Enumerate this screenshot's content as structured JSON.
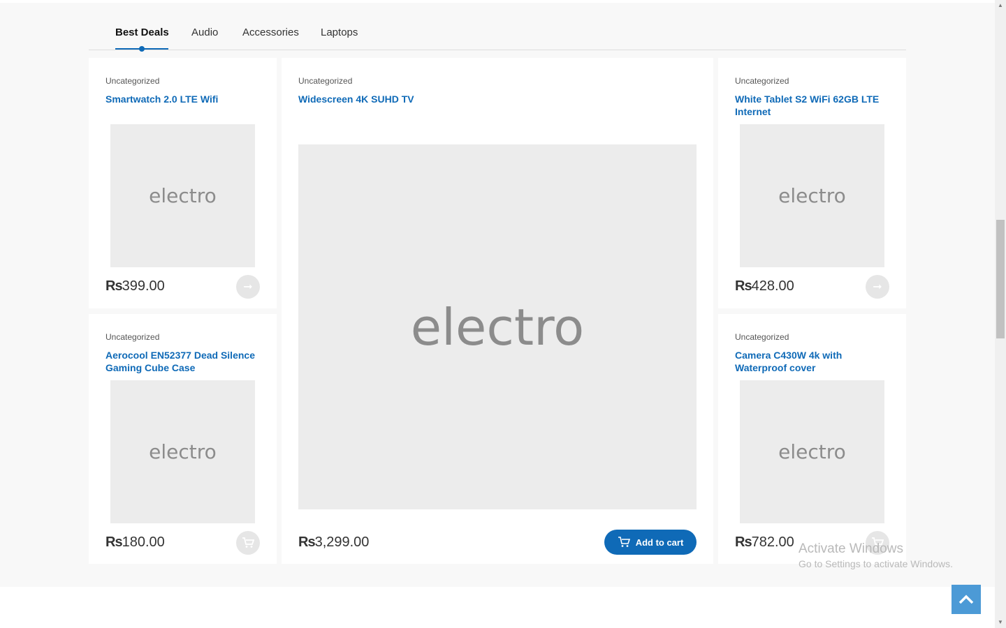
{
  "tabs": [
    {
      "label": "Best Deals",
      "active": true
    },
    {
      "label": "Audio"
    },
    {
      "label": "Accessories"
    },
    {
      "label": "Laptops"
    }
  ],
  "products": [
    {
      "category": "Uncategorized",
      "name": "Smartwatch 2.0 LTE Wifi",
      "image_text": "electro",
      "currency": "Rs",
      "amount": "399.00",
      "action_icon": "arrow-right-icon"
    },
    {
      "category": "Uncategorized",
      "name": "Widescreen 4K SUHD TV",
      "image_text": "electro",
      "currency": "Rs",
      "amount": "3,299.00",
      "action_label": "Add to cart",
      "action_icon": "cart-icon"
    },
    {
      "category": "Uncategorized",
      "name": "White Tablet S2 WiFi 62GB LTE Internet",
      "image_text": "electro",
      "currency": "Rs",
      "amount": "428.00",
      "action_icon": "arrow-right-icon"
    },
    {
      "category": "Uncategorized",
      "name": "Aerocool EN52377 Dead Silence Gaming Cube Case",
      "image_text": "electro",
      "currency": "Rs",
      "amount": "180.00",
      "action_icon": "cart-icon"
    },
    {
      "category": "Uncategorized",
      "name": "Camera C430W 4k with Waterproof cover",
      "image_text": "electro",
      "currency": "Rs",
      "amount": "782.00",
      "action_icon": "cart-icon"
    }
  ],
  "watermark": {
    "line1": "Activate Windows",
    "line2": "Go to Settings to activate Windows."
  },
  "colors": {
    "accent": "#0f6ab7",
    "background": "#f8f8f8",
    "card": "#ffffff",
    "placeholder": "#ececec",
    "back_to_top": "#4c9ad6"
  }
}
